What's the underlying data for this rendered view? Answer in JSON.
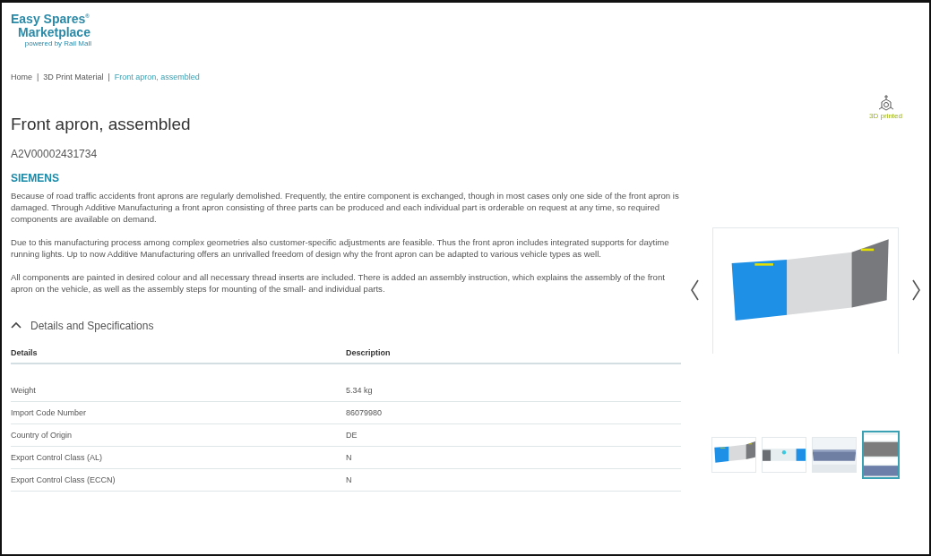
{
  "logo": {
    "line1": "Easy Spares",
    "mark": "®",
    "line2": "Marketplace",
    "tagline": "powered by Rail Mall"
  },
  "breadcrumb": [
    {
      "label": "Home",
      "selected": false
    },
    {
      "label": "3D Print Material",
      "selected": false
    },
    {
      "label": "Front apron, assembled",
      "selected": true
    }
  ],
  "breadcrumb_separator": "|",
  "product": {
    "title": "Front apron, assembled",
    "code": "A2V00002431734",
    "brand": "SIEMENS",
    "badge": "3D printed",
    "paragraphs": [
      "Because of road traffic accidents front aprons are regularly demolished. Frequently, the entire component is exchanged, though in most cases only one side of the front apron is damaged. Through Additive Manufacturing a front apron consisting of three parts can be produced and each individual part is orderable on request at any time, so required components are available on demand.",
      "Due to this manufacturing process among complex geometries also customer-specific adjustments are feasible. Thus the front apron includes integrated supports for daytime running lights. Up to now Additive Manufacturing offers an unrivalled freedom of design why the front apron can be adapted to various vehicle types as well.",
      "All components are painted in desired colour and all necessary thread inserts are included. There is added an assembly instruction, which explains the assembly of the front apron on the vehicle, as well as the assembly steps for mounting of the small- and individual parts."
    ]
  },
  "details": {
    "title": "Details and Specifications",
    "expanded": true,
    "columns": [
      "Details",
      "Description"
    ],
    "rows": [
      [
        "Weight",
        "5.34 kg"
      ],
      [
        "Import Code Number",
        "86079980"
      ],
      [
        "Country of Origin",
        "DE"
      ],
      [
        "Export Control Class (AL)",
        "N"
      ],
      [
        "Export Control Class (ECCN)",
        "N"
      ]
    ]
  },
  "gallery": {
    "thumbnails": [
      {
        "kind": "picture",
        "selected": false
      },
      {
        "kind": "picture",
        "selected": false
      },
      {
        "kind": "picture",
        "selected": false
      },
      {
        "kind": "picture",
        "selected": true
      }
    ]
  }
}
